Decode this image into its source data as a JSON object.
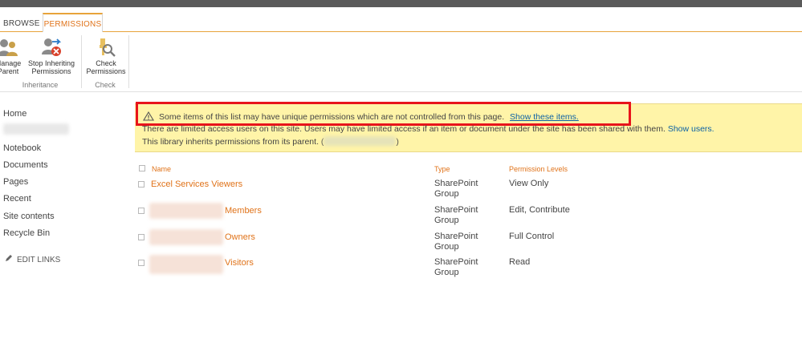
{
  "tabs": {
    "browse": "BROWSE",
    "permissions": "PERMISSIONS"
  },
  "ribbon": {
    "manage_parent": {
      "line1": "Manage",
      "line2": "Parent"
    },
    "stop_inheriting": {
      "line1": "Stop Inheriting",
      "line2": "Permissions"
    },
    "check_permissions": {
      "line1": "Check",
      "line2": "Permissions"
    },
    "group_inheritance": "Inheritance",
    "group_check": "Check"
  },
  "nav": {
    "items": [
      "Home",
      "Notebook",
      "Documents",
      "Pages",
      "Recent",
      "Site contents",
      "Recycle Bin"
    ],
    "edit_links": "EDIT LINKS"
  },
  "banner": {
    "unique_text": "Some items of this list may have unique permissions which are not controlled from this page.",
    "show_items": "Show these items.",
    "limited_text": "There are limited access users on this site. Users may have limited access if an item or document under the site has been shared with them.",
    "show_users": "Show users.",
    "inherit_text": "This library inherits permissions from its parent. (",
    "inherit_close": ")"
  },
  "table": {
    "headers": {
      "name": "Name",
      "type": "Type",
      "levels": "Permission Levels"
    },
    "rows": [
      {
        "name": "Excel Services Viewers",
        "type_line1": "SharePoint",
        "type_line2": "Group",
        "level": "View Only"
      },
      {
        "name": "Members",
        "type_line1": "SharePoint",
        "type_line2": "Group",
        "level": "Edit, Contribute"
      },
      {
        "name": "Owners",
        "type_line1": "SharePoint",
        "type_line2": "Group",
        "level": "Full Control"
      },
      {
        "name": "Visitors",
        "type_line1": "SharePoint",
        "type_line2": "Group",
        "level": "Read"
      }
    ]
  },
  "colors": {
    "accent_orange": "#e0731a",
    "link_blue": "#0b61a4",
    "banner_yellow": "#fff4a8",
    "highlight_red": "#e8141b"
  },
  "icons": [
    "manage-parent-icon",
    "stop-inheriting-icon",
    "check-permissions-icon",
    "warning-icon",
    "pencil-icon"
  ]
}
